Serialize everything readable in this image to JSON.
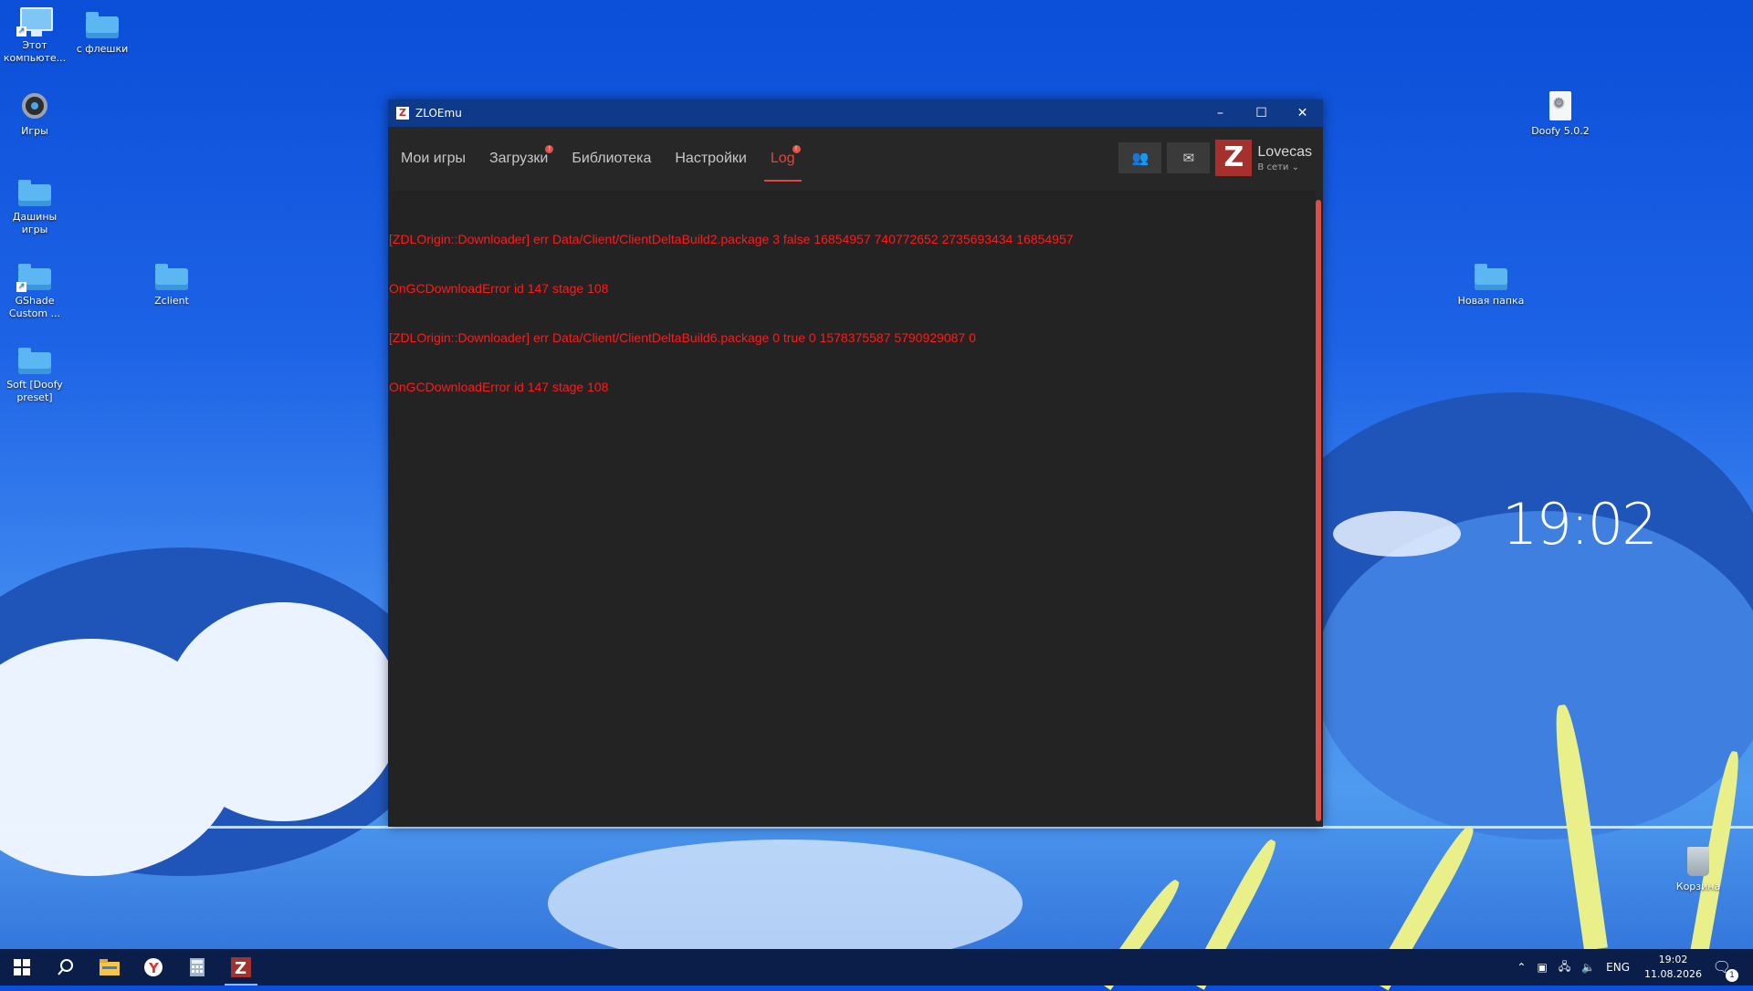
{
  "desktop": {
    "icons": [
      {
        "label": "Этот компьюте..."
      },
      {
        "label": "с флешки"
      },
      {
        "label": "Игры"
      },
      {
        "label": "Дашины игры"
      },
      {
        "label": "GShade Custom ..."
      },
      {
        "label": "Zclient"
      },
      {
        "label": "Soft [Doofy preset]"
      },
      {
        "label": "Doofy 5.0.2"
      },
      {
        "label": "Новая папка"
      },
      {
        "label": "Корзина"
      }
    ],
    "wallpaper_clock": "19:02"
  },
  "window": {
    "title": "ZLOEmu",
    "controls": {
      "minimize": "–",
      "maximize": "☐",
      "close": "✕"
    },
    "tabs": [
      {
        "label": "Мои игры"
      },
      {
        "label": "Загрузки",
        "badge": "!"
      },
      {
        "label": "Библиотека"
      },
      {
        "label": "Настройки"
      },
      {
        "label": "Log",
        "badge": "!"
      }
    ],
    "active_tab": "Log",
    "user": {
      "avatar_letter": "Z",
      "name": "Lovecas",
      "status": "В сети ⌄"
    },
    "log_lines": [
      "[ZDLOrigin::Downloader] err Data/Client/ClientDeltaBuild2.package 3 false 16854957 740772652 2735693434 16854957",
      "OnGCDownloadError id 147 stage 108",
      "[ZDLOrigin::Downloader] err Data/Client/ClientDeltaBuild6.package 0 true 0 1578375587 5790929087 0",
      "OnGCDownloadError id 147 stage 108"
    ],
    "colors": {
      "accent": "#e1463c",
      "log_text": "#ff1a1a",
      "titlebar": "#0f3a8a",
      "background": "#232323"
    }
  },
  "taskbar": {
    "apps": [
      "windows-start",
      "search",
      "file-explorer",
      "yandex-browser",
      "calculator",
      "zloemu"
    ],
    "tray": {
      "language": "ENG",
      "time": "19:02",
      "date": "11.08.2026",
      "notification_count": "1"
    }
  }
}
